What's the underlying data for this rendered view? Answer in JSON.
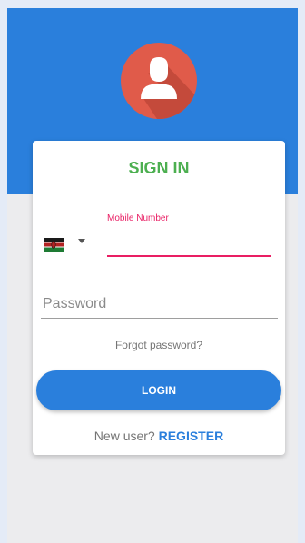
{
  "card": {
    "title": "SIGN IN"
  },
  "mobile": {
    "label": "Mobile Number",
    "value": "",
    "country_flag": "kenya-flag-icon"
  },
  "password": {
    "placeholder": "Password"
  },
  "links": {
    "forgot_password": "Forgot password?"
  },
  "login": {
    "label": "LOGIN"
  },
  "register": {
    "prompt": "New user?",
    "link_label": "REGISTER"
  },
  "colors": {
    "primary": "#2a7fdc",
    "title_green": "#4caf50",
    "accent_pink": "#e91e63",
    "avatar_red": "#e05b4a"
  }
}
